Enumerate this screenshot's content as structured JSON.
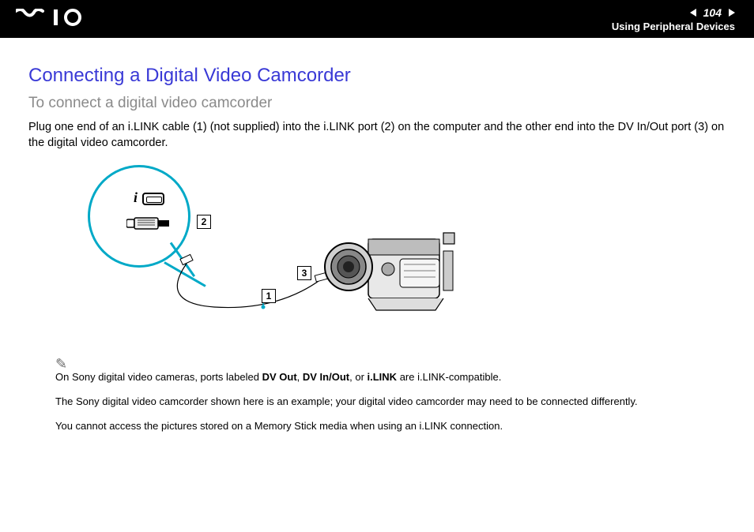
{
  "header": {
    "page_number": "104",
    "section": "Using Peripheral Devices"
  },
  "title": "Connecting a Digital Video Camcorder",
  "subtitle": "To connect a digital video camcorder",
  "body": "Plug one end of an i.LINK cable (1) (not supplied) into the i.LINK port (2) on the computer and the other end into the DV In/Out port (3) on the digital video camcorder.",
  "figure": {
    "label1": "1",
    "label2": "2",
    "label3": "3"
  },
  "notes": {
    "line1_pre": "On Sony digital video cameras, ports labeled ",
    "dv_out": "DV Out",
    "sep1": ", ",
    "dv_inout": "DV In/Out",
    "sep2": ", or ",
    "ilink": "i.LINK",
    "line1_post": " are i.LINK-compatible.",
    "line2": "The Sony digital video camcorder shown here is an example; your digital video camcorder may need to be connected differently.",
    "line3": "You cannot access the pictures stored on a Memory Stick media when using an i.LINK connection."
  }
}
